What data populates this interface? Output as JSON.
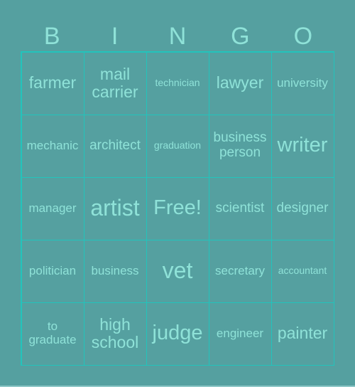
{
  "title_letters": [
    "B",
    "I",
    "N",
    "G",
    "O"
  ],
  "colors": {
    "background": "#55a0a0",
    "grid_line": "#22c4bc",
    "text": "#8fe2d8"
  },
  "cells": [
    [
      "farmer",
      "mail carrier",
      "technician",
      "lawyer",
      "university"
    ],
    [
      "mechanic",
      "architect",
      "graduation",
      "business person",
      "writer"
    ],
    [
      "manager",
      "artist",
      "Free!",
      "scientist",
      "designer"
    ],
    [
      "politician",
      "business",
      "vet",
      "secretary",
      "accountant"
    ],
    [
      "to graduate",
      "high school",
      "judge",
      "engineer",
      "painter"
    ]
  ]
}
